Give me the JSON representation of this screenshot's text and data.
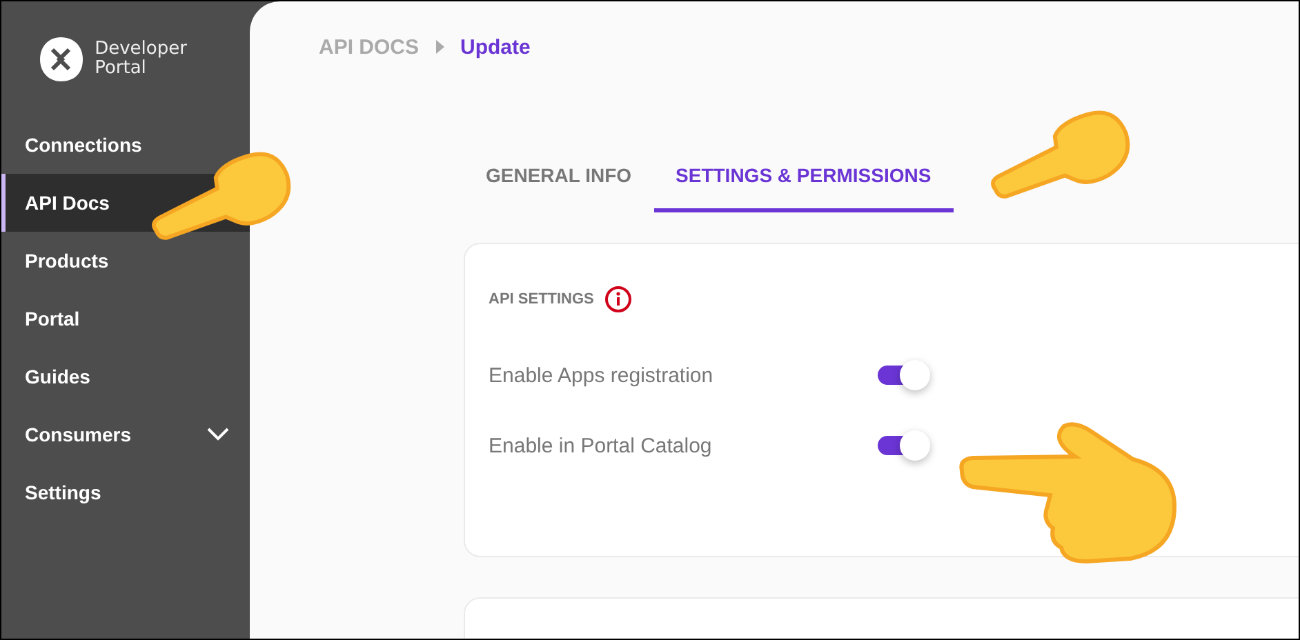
{
  "sidebar": {
    "logo": {
      "line1": "Developer",
      "line2": "Portal"
    },
    "items": [
      {
        "label": "Connections",
        "kind": "link",
        "selected": false
      },
      {
        "label": "API Docs",
        "kind": "link",
        "selected": true
      },
      {
        "label": "Products",
        "kind": "link",
        "selected": false
      },
      {
        "label": "Portal",
        "kind": "link",
        "selected": false
      },
      {
        "label": "Guides",
        "kind": "link",
        "selected": false
      },
      {
        "label": "Consumers",
        "kind": "group",
        "selected": false,
        "expanded": false
      },
      {
        "label": "Settings",
        "kind": "link",
        "selected": false
      }
    ]
  },
  "breadcrumb": [
    {
      "label": "API DOCS",
      "current": false
    },
    {
      "label": "Update",
      "current": true
    }
  ],
  "tabs": [
    {
      "label": "GENERAL INFO",
      "selected": false
    },
    {
      "label": "SETTINGS & PERMISSIONS",
      "selected": true
    }
  ],
  "settings_card": {
    "title": "API SETTINGS",
    "toggles": [
      {
        "label": "Enable Apps registration",
        "on": true
      },
      {
        "label": "Enable in Portal Catalog",
        "on": true
      }
    ]
  }
}
